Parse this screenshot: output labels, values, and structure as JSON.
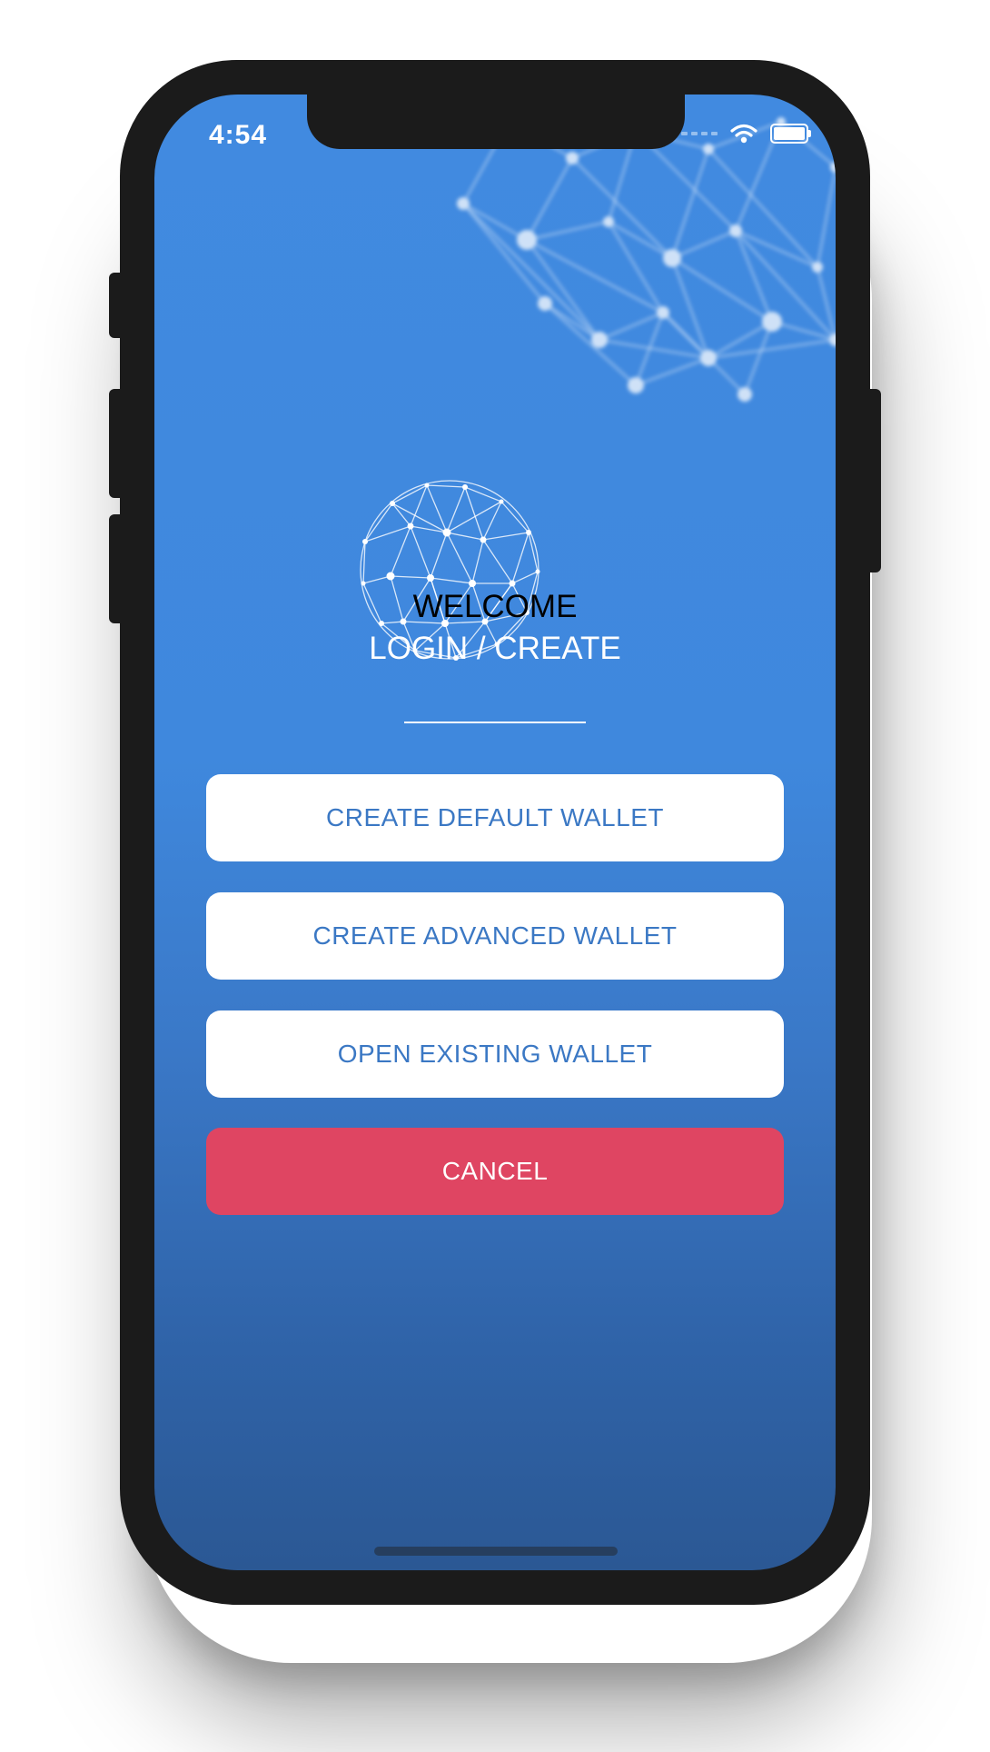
{
  "status_bar": {
    "time": "4:54",
    "wifi_icon": "wifi-icon",
    "battery_icon": "battery-icon"
  },
  "welcome": {
    "title": "WELCOME",
    "subtitle": "LOGIN / CREATE"
  },
  "actions": {
    "create_default": "CREATE DEFAULT WALLET",
    "create_advanced": "CREATE ADVANCED WALLET",
    "open_existing": "OPEN EXISTING WALLET",
    "cancel": "CANCEL"
  },
  "colors": {
    "background_top": "#418ae0",
    "background_bottom": "#2b5894",
    "button_text": "#3b78c4",
    "cancel": "#df4562"
  },
  "icons": {
    "logo": "network-globe-icon",
    "background": "network-graph-decoration"
  }
}
